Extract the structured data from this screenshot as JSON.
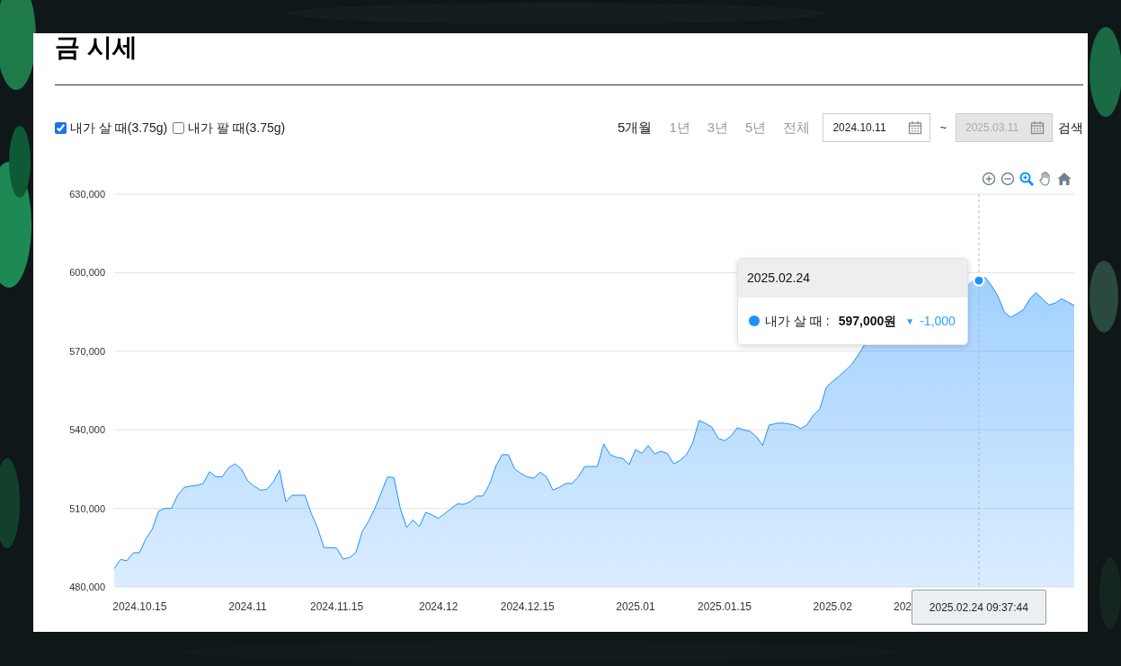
{
  "page": {
    "title": "금 시세"
  },
  "options": [
    {
      "label": "내가 살 때(3.75g)",
      "checked": true
    },
    {
      "label": "내가 팔 때(3.75g)",
      "checked": false
    }
  ],
  "periods": [
    {
      "label": "5개월",
      "selected": true
    },
    {
      "label": "1년",
      "selected": false
    },
    {
      "label": "3년",
      "selected": false
    },
    {
      "label": "5년",
      "selected": false
    },
    {
      "label": "전체",
      "selected": false
    }
  ],
  "date_range": {
    "start": {
      "value": "2024.10.11",
      "disabled": false
    },
    "separator": "~",
    "end": {
      "value": "2025.03.11",
      "disabled": true
    },
    "search_button": "검색"
  },
  "chart": {
    "chart_data": {
      "type": "area",
      "grid": true,
      "ylim": [
        480000,
        630000
      ],
      "yticks": [
        {
          "value": 480000,
          "label": "480,000"
        },
        {
          "value": 510000,
          "label": "510,000"
        },
        {
          "value": 540000,
          "label": "540,000"
        },
        {
          "value": 570000,
          "label": "570,000"
        },
        {
          "value": 600000,
          "label": "600,000"
        },
        {
          "value": 630000,
          "label": "630,000"
        }
      ],
      "categories": [
        null,
        null,
        null,
        null,
        "2024.10.15",
        null,
        null,
        null,
        null,
        null,
        null,
        null,
        null,
        null,
        null,
        null,
        null,
        null,
        null,
        null,
        null,
        "2024.11",
        null,
        null,
        null,
        null,
        null,
        null,
        null,
        null,
        null,
        null,
        null,
        null,
        null,
        "2024.11.15",
        null,
        null,
        null,
        null,
        null,
        null,
        null,
        null,
        null,
        null,
        null,
        null,
        null,
        null,
        null,
        "2024.12",
        null,
        null,
        null,
        null,
        null,
        null,
        null,
        null,
        null,
        null,
        null,
        null,
        null,
        "2024.12.15",
        null,
        null,
        null,
        null,
        null,
        null,
        null,
        null,
        null,
        null,
        null,
        null,
        null,
        null,
        null,
        null,
        "2025.01",
        null,
        null,
        null,
        null,
        null,
        null,
        null,
        null,
        null,
        null,
        null,
        null,
        null,
        "2025.01.15",
        null,
        null,
        null,
        null,
        null,
        null,
        null,
        null,
        null,
        null,
        null,
        null,
        null,
        null,
        null,
        null,
        "2025.02",
        null,
        null,
        null,
        null,
        null,
        null,
        null,
        null,
        null,
        null,
        "202",
        null,
        null,
        null,
        null,
        null,
        null,
        null,
        null,
        null,
        null,
        null,
        null,
        null,
        null,
        null,
        null,
        null,
        null,
        null,
        null,
        null,
        null,
        null,
        null,
        null,
        null,
        null
      ],
      "series": [
        {
          "name": "내가 살 때",
          "color": "#1e90ff",
          "values": [
            487000,
            490500,
            490000,
            493000,
            493100,
            498500,
            502000,
            509000,
            510000,
            510000,
            515000,
            518000,
            518500,
            518800,
            519500,
            524000,
            522000,
            522000,
            525500,
            527000,
            525000,
            520500,
            518500,
            517000,
            517200,
            520000,
            524600,
            512500,
            515000,
            515000,
            515000,
            508000,
            502500,
            495000,
            495000,
            494800,
            490600,
            491200,
            493000,
            501000,
            505000,
            510000,
            516000,
            522000,
            521700,
            510000,
            502700,
            505600,
            503000,
            508500,
            507500,
            506200,
            508000,
            510000,
            511700,
            511500,
            512500,
            514700,
            514700,
            519000,
            526000,
            530500,
            530500,
            525000,
            523300,
            522000,
            521500,
            523800,
            522000,
            517000,
            518000,
            519500,
            519500,
            522000,
            526000,
            526000,
            526000,
            534600,
            530500,
            529500,
            529100,
            526700,
            532500,
            531000,
            534000,
            530800,
            531800,
            531000,
            527000,
            528300,
            530500,
            535000,
            543500,
            542500,
            541000,
            536800,
            535800,
            537600,
            540800,
            540000,
            539400,
            537400,
            534000,
            541800,
            542400,
            542600,
            542300,
            541800,
            540400,
            542000,
            545700,
            548000,
            556300,
            558500,
            560500,
            562700,
            565000,
            568500,
            572400,
            null,
            null,
            null,
            null,
            null,
            null,
            null,
            null,
            null,
            null,
            null,
            null,
            null,
            null,
            null,
            null,
            596800,
            597000,
            598200,
            595000,
            591000,
            585000,
            583000,
            584300,
            585900,
            589900,
            592400,
            590000,
            587700,
            588400,
            590000,
            588800,
            587500
          ]
        }
      ]
    },
    "tools": [
      {
        "kind": "zoom_in"
      },
      {
        "kind": "zoom_out"
      },
      {
        "kind": "selection_zoom",
        "selected": true
      },
      {
        "kind": "pan",
        "selected": false
      },
      {
        "kind": "reset"
      }
    ],
    "crosshair": {
      "x_label": "2025.02.24 09:37:44"
    },
    "tooltip": {
      "title": "2025.02.24",
      "separator": ":",
      "value": "597,000원",
      "change_arrow": "▼",
      "change": "-1,000"
    }
  }
}
